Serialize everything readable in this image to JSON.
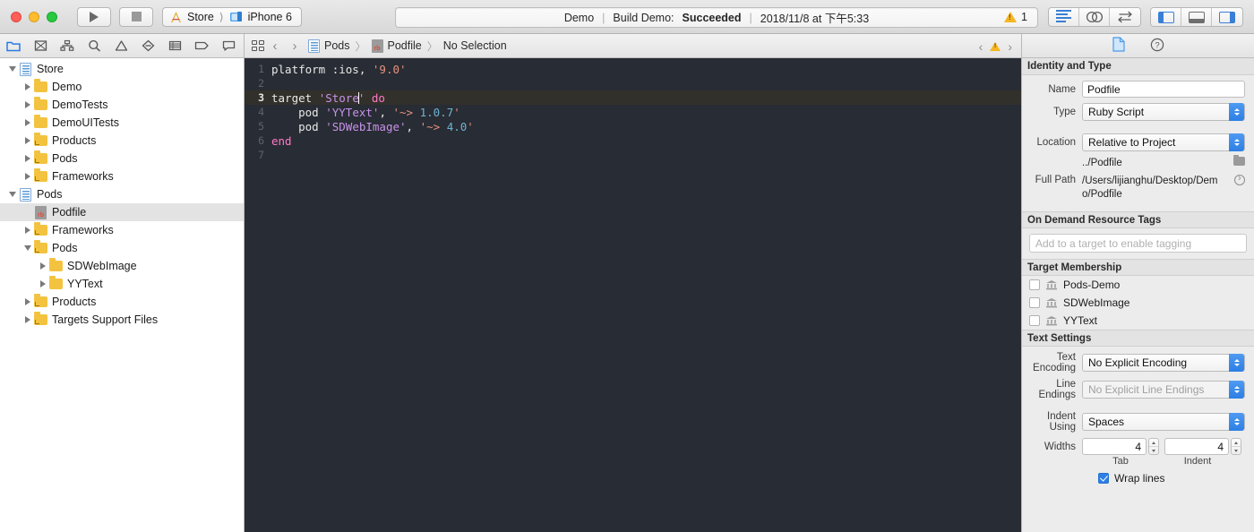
{
  "toolbar": {
    "run_label": "run-button",
    "stop_label": "stop-button",
    "scheme_target": "Store",
    "scheme_device": "iPhone 6",
    "status_project": "Demo",
    "status_build": "Build Demo:",
    "status_result": "Succeeded",
    "status_time": "2018/11/8 at 下午5:33",
    "warning_count": "1",
    "divider": "|"
  },
  "navigator": {
    "tabs": [
      {
        "name": "project-navigator",
        "selected": true
      },
      {
        "name": "source-control-navigator",
        "selected": false
      },
      {
        "name": "symbol-navigator",
        "selected": false
      },
      {
        "name": "find-navigator",
        "selected": false
      },
      {
        "name": "issue-navigator",
        "selected": false
      },
      {
        "name": "test-navigator",
        "selected": false
      },
      {
        "name": "debug-navigator",
        "selected": false
      },
      {
        "name": "breakpoint-navigator",
        "selected": false
      },
      {
        "name": "report-navigator",
        "selected": false
      }
    ],
    "tree": [
      {
        "label": "Store",
        "indent": 0,
        "icon": "project",
        "disclosure": "open",
        "selected": false
      },
      {
        "label": "Demo",
        "indent": 1,
        "icon": "folder",
        "disclosure": "closed",
        "selected": false
      },
      {
        "label": "DemoTests",
        "indent": 1,
        "icon": "folder",
        "disclosure": "closed",
        "selected": false
      },
      {
        "label": "DemoUITests",
        "indent": 1,
        "icon": "folder",
        "disclosure": "closed",
        "selected": false
      },
      {
        "label": "Products",
        "indent": 1,
        "icon": "group",
        "disclosure": "closed",
        "selected": false
      },
      {
        "label": "Pods",
        "indent": 1,
        "icon": "group",
        "disclosure": "closed",
        "selected": false
      },
      {
        "label": "Frameworks",
        "indent": 1,
        "icon": "group",
        "disclosure": "closed",
        "selected": false
      },
      {
        "label": "Pods",
        "indent": 0,
        "icon": "project",
        "disclosure": "open",
        "selected": false
      },
      {
        "label": "Podfile",
        "indent": 1,
        "icon": "ruby",
        "disclosure": "none",
        "selected": true
      },
      {
        "label": "Frameworks",
        "indent": 1,
        "icon": "group",
        "disclosure": "closed",
        "selected": false
      },
      {
        "label": "Pods",
        "indent": 1,
        "icon": "group",
        "disclosure": "open",
        "selected": false
      },
      {
        "label": "SDWebImage",
        "indent": 2,
        "icon": "folder",
        "disclosure": "closed",
        "selected": false
      },
      {
        "label": "YYText",
        "indent": 2,
        "icon": "folder",
        "disclosure": "closed",
        "selected": false
      },
      {
        "label": "Products",
        "indent": 1,
        "icon": "group",
        "disclosure": "closed",
        "selected": false
      },
      {
        "label": "Targets Support Files",
        "indent": 1,
        "icon": "group",
        "disclosure": "closed",
        "selected": false
      }
    ]
  },
  "editor": {
    "breadcrumb": [
      {
        "label": "Pods",
        "icon": "project-icon"
      },
      {
        "label": "Podfile",
        "icon": "ruby-icon"
      },
      {
        "label": "No Selection",
        "icon": "none"
      }
    ],
    "separator": "〉",
    "back_arrow": "‹",
    "forward_arrow": "›",
    "issue_prev": "‹",
    "issue_next": "›",
    "lines": [
      {
        "num": "1",
        "current": false,
        "tokens": [
          {
            "t": "platform :ios, ",
            "c": "plain"
          },
          {
            "t": "'9.0'",
            "c": "str"
          }
        ]
      },
      {
        "num": "2",
        "current": false,
        "tokens": []
      },
      {
        "num": "3",
        "current": true,
        "tokens": [
          {
            "t": "target ",
            "c": "plain"
          },
          {
            "t": "'Store",
            "c": "str2"
          },
          {
            "t": "CARET",
            "c": "caret"
          },
          {
            "t": "'",
            "c": "str2"
          },
          {
            "t": " ",
            "c": "plain"
          },
          {
            "t": "do",
            "c": "kw"
          }
        ]
      },
      {
        "num": "4",
        "current": false,
        "tokens": [
          {
            "t": "    pod ",
            "c": "plain"
          },
          {
            "t": "'YYText'",
            "c": "str2"
          },
          {
            "t": ", ",
            "c": "plain"
          },
          {
            "t": "'~> ",
            "c": "str"
          },
          {
            "t": "1.0.7",
            "c": "num"
          },
          {
            "t": "'",
            "c": "str"
          }
        ]
      },
      {
        "num": "5",
        "current": false,
        "tokens": [
          {
            "t": "    pod ",
            "c": "plain"
          },
          {
            "t": "'SDWebImage'",
            "c": "str2"
          },
          {
            "t": ", ",
            "c": "plain"
          },
          {
            "t": "'~> ",
            "c": "str"
          },
          {
            "t": "4.0",
            "c": "num"
          },
          {
            "t": "'",
            "c": "str"
          }
        ]
      },
      {
        "num": "6",
        "current": false,
        "tokens": [
          {
            "t": "end",
            "c": "kw"
          }
        ]
      },
      {
        "num": "7",
        "current": false,
        "tokens": []
      }
    ]
  },
  "inspector": {
    "tabs": [
      {
        "name": "file-inspector",
        "selected": true
      },
      {
        "name": "quick-help-inspector",
        "selected": false
      }
    ],
    "identity": {
      "header": "Identity and Type",
      "name_label": "Name",
      "name_value": "Podfile",
      "type_label": "Type",
      "type_value": "Ruby Script",
      "location_label": "Location",
      "location_value": "Relative to Project",
      "relative_path": "../Podfile",
      "fullpath_label": "Full Path",
      "fullpath_value": "/Users/lijianghu/Desktop/Demo/Podfile"
    },
    "odr": {
      "header": "On Demand Resource Tags",
      "placeholder": "Add to a target to enable tagging",
      "value": ""
    },
    "target_membership": {
      "header": "Target Membership",
      "rows": [
        {
          "label": "Pods-Demo",
          "checked": false
        },
        {
          "label": "SDWebImage",
          "checked": false
        },
        {
          "label": "YYText",
          "checked": false
        }
      ]
    },
    "text_settings": {
      "header": "Text Settings",
      "encoding_label": "Text Encoding",
      "encoding_value": "No Explicit Encoding",
      "line_endings_label": "Line Endings",
      "line_endings_value": "No Explicit Line Endings",
      "indent_label": "Indent Using",
      "indent_value": "Spaces",
      "widths_label": "Widths",
      "tab_width": "4",
      "indent_width": "4",
      "tab_caption": "Tab",
      "indent_caption": "Indent",
      "wrap_label": "Wrap lines",
      "wrap_checked": true
    }
  },
  "colors": {
    "accent": "#2d7fe4",
    "editor_bg": "#282c34",
    "keyword": "#ff79c6",
    "string": "#e8927c",
    "symbol": "#c792ea",
    "number": "#6fb3d2",
    "warning": "#f5b622",
    "folder": "#f3c340"
  }
}
